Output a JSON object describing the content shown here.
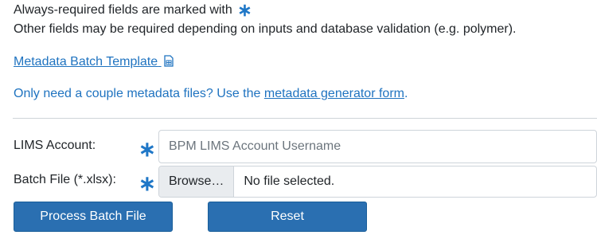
{
  "intro": {
    "required_note": "Always-required fields are marked with",
    "required_symbol": "∗",
    "other_note": "Other fields may be required depending on inputs and database validation (e.g. polymer)."
  },
  "template_link": {
    "label": "Metadata Batch Template",
    "icon": "spreadsheet-icon"
  },
  "generator_note": {
    "prefix": "Only need a couple metadata files? Use the",
    "link_label": "metadata generator form",
    "suffix": "."
  },
  "form": {
    "lims_account": {
      "label": "LIMS Account:",
      "required_symbol": "∗",
      "placeholder": "BPM LIMS Account Username",
      "value": ""
    },
    "batch_file": {
      "label": "Batch File (*.xlsx):",
      "required_symbol": "∗",
      "browse_label": "Browse…",
      "status": "No file selected."
    },
    "process_button": "Process Batch File",
    "reset_button": "Reset"
  },
  "colors": {
    "accent": "#1f73c0",
    "button": "#2a6fb1",
    "text": "#212529"
  }
}
